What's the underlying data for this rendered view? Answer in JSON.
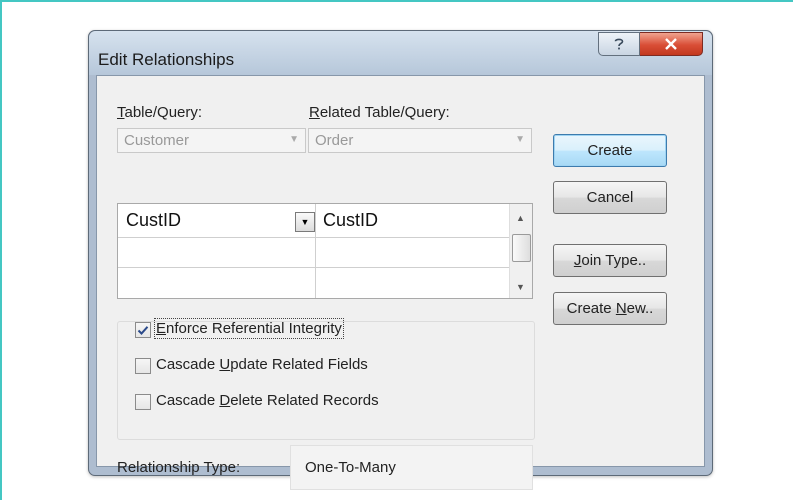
{
  "dialog": {
    "title": "Edit Relationships"
  },
  "labels": {
    "table_query_u": "T",
    "table_query_rest": "able/Query:",
    "related_table_u": "R",
    "related_table_rest": "elated Table/Query:"
  },
  "combos": {
    "table": "Customer",
    "related_table": "Order"
  },
  "grid": {
    "row1_left": "CustID",
    "row1_right": "CustID"
  },
  "options": {
    "enforce_u": "E",
    "enforce_rest": "nforce Referential Integrity",
    "enforce_checked": true,
    "cascade_update_pre": "Cascade ",
    "cascade_update_u": "U",
    "cascade_update_rest": "pdate Related Fields",
    "cascade_update_checked": false,
    "cascade_delete_pre": "Cascade ",
    "cascade_delete_u": "D",
    "cascade_delete_rest": "elete Related Records",
    "cascade_delete_checked": false
  },
  "relationship": {
    "label": "Relationship Type:",
    "value": "One-To-Many"
  },
  "buttons": {
    "create": "Create",
    "cancel": "Cancel",
    "join_type_u": "J",
    "join_type_rest": "oin Type..",
    "create_new_pre": "Create ",
    "create_new_u": "N",
    "create_new_rest": "ew.."
  },
  "icons": {
    "help": "help-icon",
    "close": "close-icon",
    "dropdown": "chevron-down-icon",
    "check": "checkmark-icon"
  },
  "colors": {
    "accent_frame": "#44c7c3",
    "close_button": "#c2381f",
    "default_button": "#bee6fd"
  }
}
